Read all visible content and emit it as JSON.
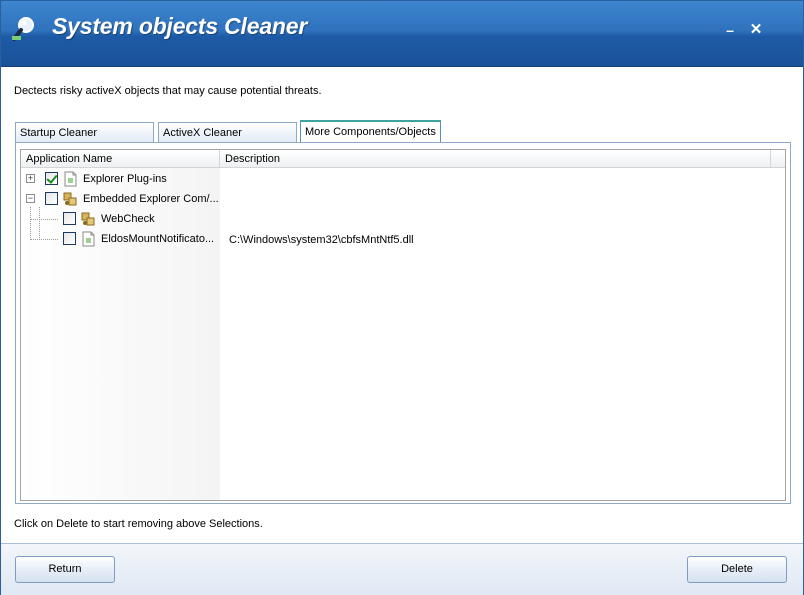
{
  "window": {
    "title": "System objects Cleaner",
    "minimize": "–",
    "close": "✕"
  },
  "subtitle": "Dectects risky activeX objects that may cause potential threats.",
  "tabs": [
    {
      "label": "Startup Cleaner"
    },
    {
      "label": "ActiveX Cleaner"
    },
    {
      "label": "More Components/Objects",
      "active": true
    }
  ],
  "list": {
    "columns": [
      {
        "label": "Application Name"
      },
      {
        "label": "Description"
      }
    ],
    "rows": [
      {
        "name": "Explorer Plug-ins",
        "description": "",
        "expander": "+",
        "checked": true,
        "icon": "page-icon"
      },
      {
        "name": "Embedded Explorer Com/...",
        "description": "",
        "expander": "−",
        "checked": false,
        "icon": "component-icon"
      },
      {
        "name": "WebCheck",
        "description": "",
        "checked": false,
        "icon": "component-icon"
      },
      {
        "name": "EldosMountNotificato...",
        "description": "C:\\Windows\\system32\\cbfsMntNtf5.dll",
        "checked": false,
        "icon": "page-icon"
      }
    ]
  },
  "hint": "Click on Delete to start removing above Selections.",
  "buttons": {
    "return": "Return",
    "delete": "Delete"
  },
  "colors": {
    "titlebar": "#2f72bd",
    "active_tab_accent": "#3fa3a0"
  }
}
